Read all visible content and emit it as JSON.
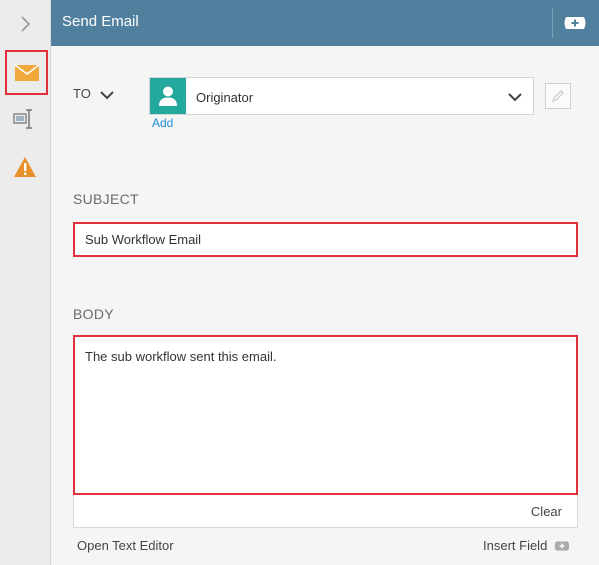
{
  "header": {
    "title": "Send Email"
  },
  "to": {
    "label": "TO",
    "recipient": "Originator",
    "add_link": "Add"
  },
  "subject": {
    "label": "SUBJECT",
    "value": "Sub Workflow Email"
  },
  "body": {
    "label": "BODY",
    "value": "The sub workflow sent this email.",
    "clear_link": "Clear"
  },
  "footer": {
    "open_text_editor": "Open Text Editor",
    "insert_field": "Insert Field"
  },
  "rail": {
    "icons": [
      "chevron-right-icon",
      "envelope-icon",
      "properties-icon",
      "warning-icon"
    ]
  },
  "colors": {
    "header_bg": "#51809e",
    "highlight": "#e0313b",
    "envelope": "#f2a93b",
    "warning": "#e8912b",
    "avatar_bg": "#22a89c",
    "link": "#1c8fd6"
  }
}
